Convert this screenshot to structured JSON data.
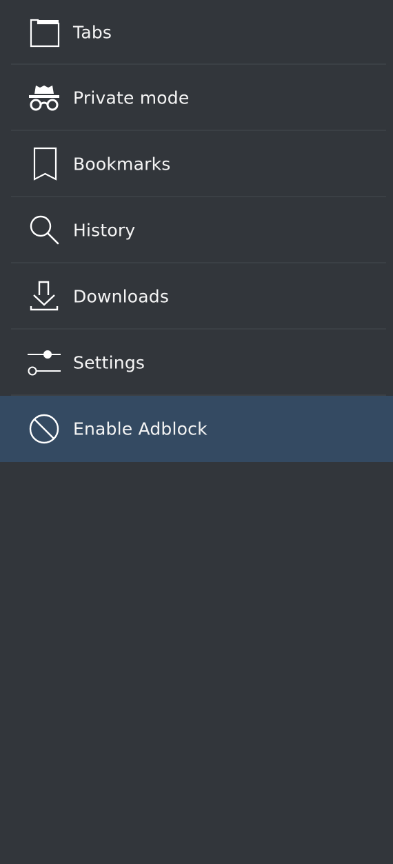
{
  "menu": {
    "items": [
      {
        "label": "Tabs",
        "icon": "tabs-icon"
      },
      {
        "label": "Private mode",
        "icon": "incognito-icon"
      },
      {
        "label": "Bookmarks",
        "icon": "bookmark-icon"
      },
      {
        "label": "History",
        "icon": "search-icon"
      },
      {
        "label": "Downloads",
        "icon": "download-icon"
      },
      {
        "label": "Settings",
        "icon": "sliders-icon"
      },
      {
        "label": "Enable Adblock",
        "icon": "block-icon",
        "highlighted": true
      }
    ]
  },
  "colors": {
    "background": "#32363b",
    "divider": "#3b4045",
    "highlight": "#344a62",
    "text": "#f4f4f4"
  }
}
